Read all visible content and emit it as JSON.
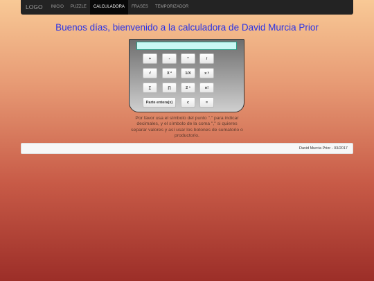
{
  "nav": {
    "brand": "LOGO",
    "items": [
      "INICIO",
      "PUZZLE",
      "CALCULADORA",
      "FRASES",
      "TEMPORIZADOR"
    ],
    "active_index": 2
  },
  "page_title": "Buenos días, bienvenido a la calculadora de David Murcia Prior",
  "calculator": {
    "display_value": "",
    "rows": [
      [
        "+",
        "-",
        "*",
        "/"
      ],
      [
        "√",
        "X ²",
        "1/X",
        "x ʸ"
      ],
      [
        "∑",
        "∏",
        "2 ⁿ",
        "n!"
      ],
      [
        "Parte entera(x)",
        "c",
        "="
      ]
    ]
  },
  "instructions": "Por favor usa el símbolo del punto \".\" para indicar decimales, y el símbolo de la coma \",\" si quieres separar valores y así usar los botones de sumatorio o productorio.",
  "footer": {
    "text": "David Murcia Prior - 03/2017"
  },
  "colors": {
    "title": "#2a33e6",
    "navbar": "#232323",
    "display": "#c9f8f4"
  }
}
